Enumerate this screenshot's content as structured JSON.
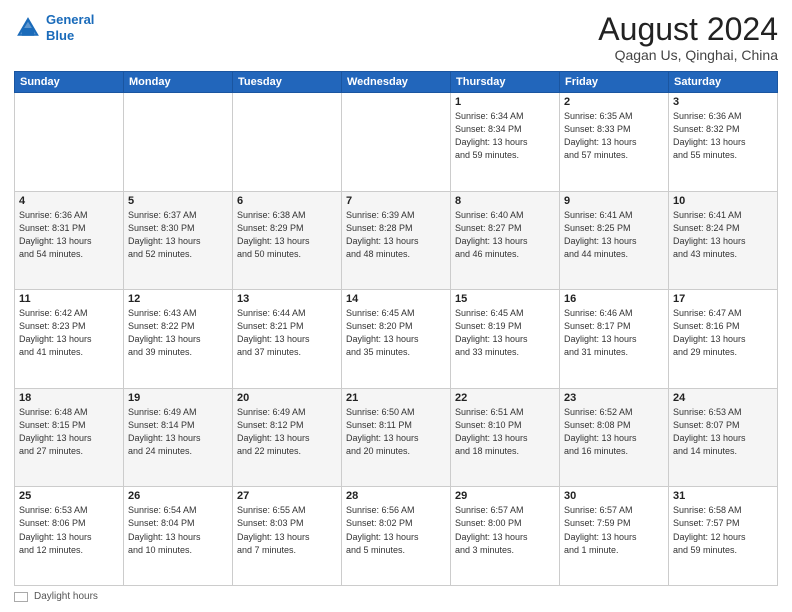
{
  "header": {
    "logo_line1": "General",
    "logo_line2": "Blue",
    "month": "August 2024",
    "location": "Qagan Us, Qinghai, China"
  },
  "days_of_week": [
    "Sunday",
    "Monday",
    "Tuesday",
    "Wednesday",
    "Thursday",
    "Friday",
    "Saturday"
  ],
  "weeks": [
    [
      {
        "day": "",
        "info": ""
      },
      {
        "day": "",
        "info": ""
      },
      {
        "day": "",
        "info": ""
      },
      {
        "day": "",
        "info": ""
      },
      {
        "day": "1",
        "info": "Sunrise: 6:34 AM\nSunset: 8:34 PM\nDaylight: 13 hours\nand 59 minutes."
      },
      {
        "day": "2",
        "info": "Sunrise: 6:35 AM\nSunset: 8:33 PM\nDaylight: 13 hours\nand 57 minutes."
      },
      {
        "day": "3",
        "info": "Sunrise: 6:36 AM\nSunset: 8:32 PM\nDaylight: 13 hours\nand 55 minutes."
      }
    ],
    [
      {
        "day": "4",
        "info": "Sunrise: 6:36 AM\nSunset: 8:31 PM\nDaylight: 13 hours\nand 54 minutes."
      },
      {
        "day": "5",
        "info": "Sunrise: 6:37 AM\nSunset: 8:30 PM\nDaylight: 13 hours\nand 52 minutes."
      },
      {
        "day": "6",
        "info": "Sunrise: 6:38 AM\nSunset: 8:29 PM\nDaylight: 13 hours\nand 50 minutes."
      },
      {
        "day": "7",
        "info": "Sunrise: 6:39 AM\nSunset: 8:28 PM\nDaylight: 13 hours\nand 48 minutes."
      },
      {
        "day": "8",
        "info": "Sunrise: 6:40 AM\nSunset: 8:27 PM\nDaylight: 13 hours\nand 46 minutes."
      },
      {
        "day": "9",
        "info": "Sunrise: 6:41 AM\nSunset: 8:25 PM\nDaylight: 13 hours\nand 44 minutes."
      },
      {
        "day": "10",
        "info": "Sunrise: 6:41 AM\nSunset: 8:24 PM\nDaylight: 13 hours\nand 43 minutes."
      }
    ],
    [
      {
        "day": "11",
        "info": "Sunrise: 6:42 AM\nSunset: 8:23 PM\nDaylight: 13 hours\nand 41 minutes."
      },
      {
        "day": "12",
        "info": "Sunrise: 6:43 AM\nSunset: 8:22 PM\nDaylight: 13 hours\nand 39 minutes."
      },
      {
        "day": "13",
        "info": "Sunrise: 6:44 AM\nSunset: 8:21 PM\nDaylight: 13 hours\nand 37 minutes."
      },
      {
        "day": "14",
        "info": "Sunrise: 6:45 AM\nSunset: 8:20 PM\nDaylight: 13 hours\nand 35 minutes."
      },
      {
        "day": "15",
        "info": "Sunrise: 6:45 AM\nSunset: 8:19 PM\nDaylight: 13 hours\nand 33 minutes."
      },
      {
        "day": "16",
        "info": "Sunrise: 6:46 AM\nSunset: 8:17 PM\nDaylight: 13 hours\nand 31 minutes."
      },
      {
        "day": "17",
        "info": "Sunrise: 6:47 AM\nSunset: 8:16 PM\nDaylight: 13 hours\nand 29 minutes."
      }
    ],
    [
      {
        "day": "18",
        "info": "Sunrise: 6:48 AM\nSunset: 8:15 PM\nDaylight: 13 hours\nand 27 minutes."
      },
      {
        "day": "19",
        "info": "Sunrise: 6:49 AM\nSunset: 8:14 PM\nDaylight: 13 hours\nand 24 minutes."
      },
      {
        "day": "20",
        "info": "Sunrise: 6:49 AM\nSunset: 8:12 PM\nDaylight: 13 hours\nand 22 minutes."
      },
      {
        "day": "21",
        "info": "Sunrise: 6:50 AM\nSunset: 8:11 PM\nDaylight: 13 hours\nand 20 minutes."
      },
      {
        "day": "22",
        "info": "Sunrise: 6:51 AM\nSunset: 8:10 PM\nDaylight: 13 hours\nand 18 minutes."
      },
      {
        "day": "23",
        "info": "Sunrise: 6:52 AM\nSunset: 8:08 PM\nDaylight: 13 hours\nand 16 minutes."
      },
      {
        "day": "24",
        "info": "Sunrise: 6:53 AM\nSunset: 8:07 PM\nDaylight: 13 hours\nand 14 minutes."
      }
    ],
    [
      {
        "day": "25",
        "info": "Sunrise: 6:53 AM\nSunset: 8:06 PM\nDaylight: 13 hours\nand 12 minutes."
      },
      {
        "day": "26",
        "info": "Sunrise: 6:54 AM\nSunset: 8:04 PM\nDaylight: 13 hours\nand 10 minutes."
      },
      {
        "day": "27",
        "info": "Sunrise: 6:55 AM\nSunset: 8:03 PM\nDaylight: 13 hours\nand 7 minutes."
      },
      {
        "day": "28",
        "info": "Sunrise: 6:56 AM\nSunset: 8:02 PM\nDaylight: 13 hours\nand 5 minutes."
      },
      {
        "day": "29",
        "info": "Sunrise: 6:57 AM\nSunset: 8:00 PM\nDaylight: 13 hours\nand 3 minutes."
      },
      {
        "day": "30",
        "info": "Sunrise: 6:57 AM\nSunset: 7:59 PM\nDaylight: 13 hours\nand 1 minute."
      },
      {
        "day": "31",
        "info": "Sunrise: 6:58 AM\nSunset: 7:57 PM\nDaylight: 12 hours\nand 59 minutes."
      }
    ]
  ],
  "footer": {
    "note": "Daylight hours"
  }
}
